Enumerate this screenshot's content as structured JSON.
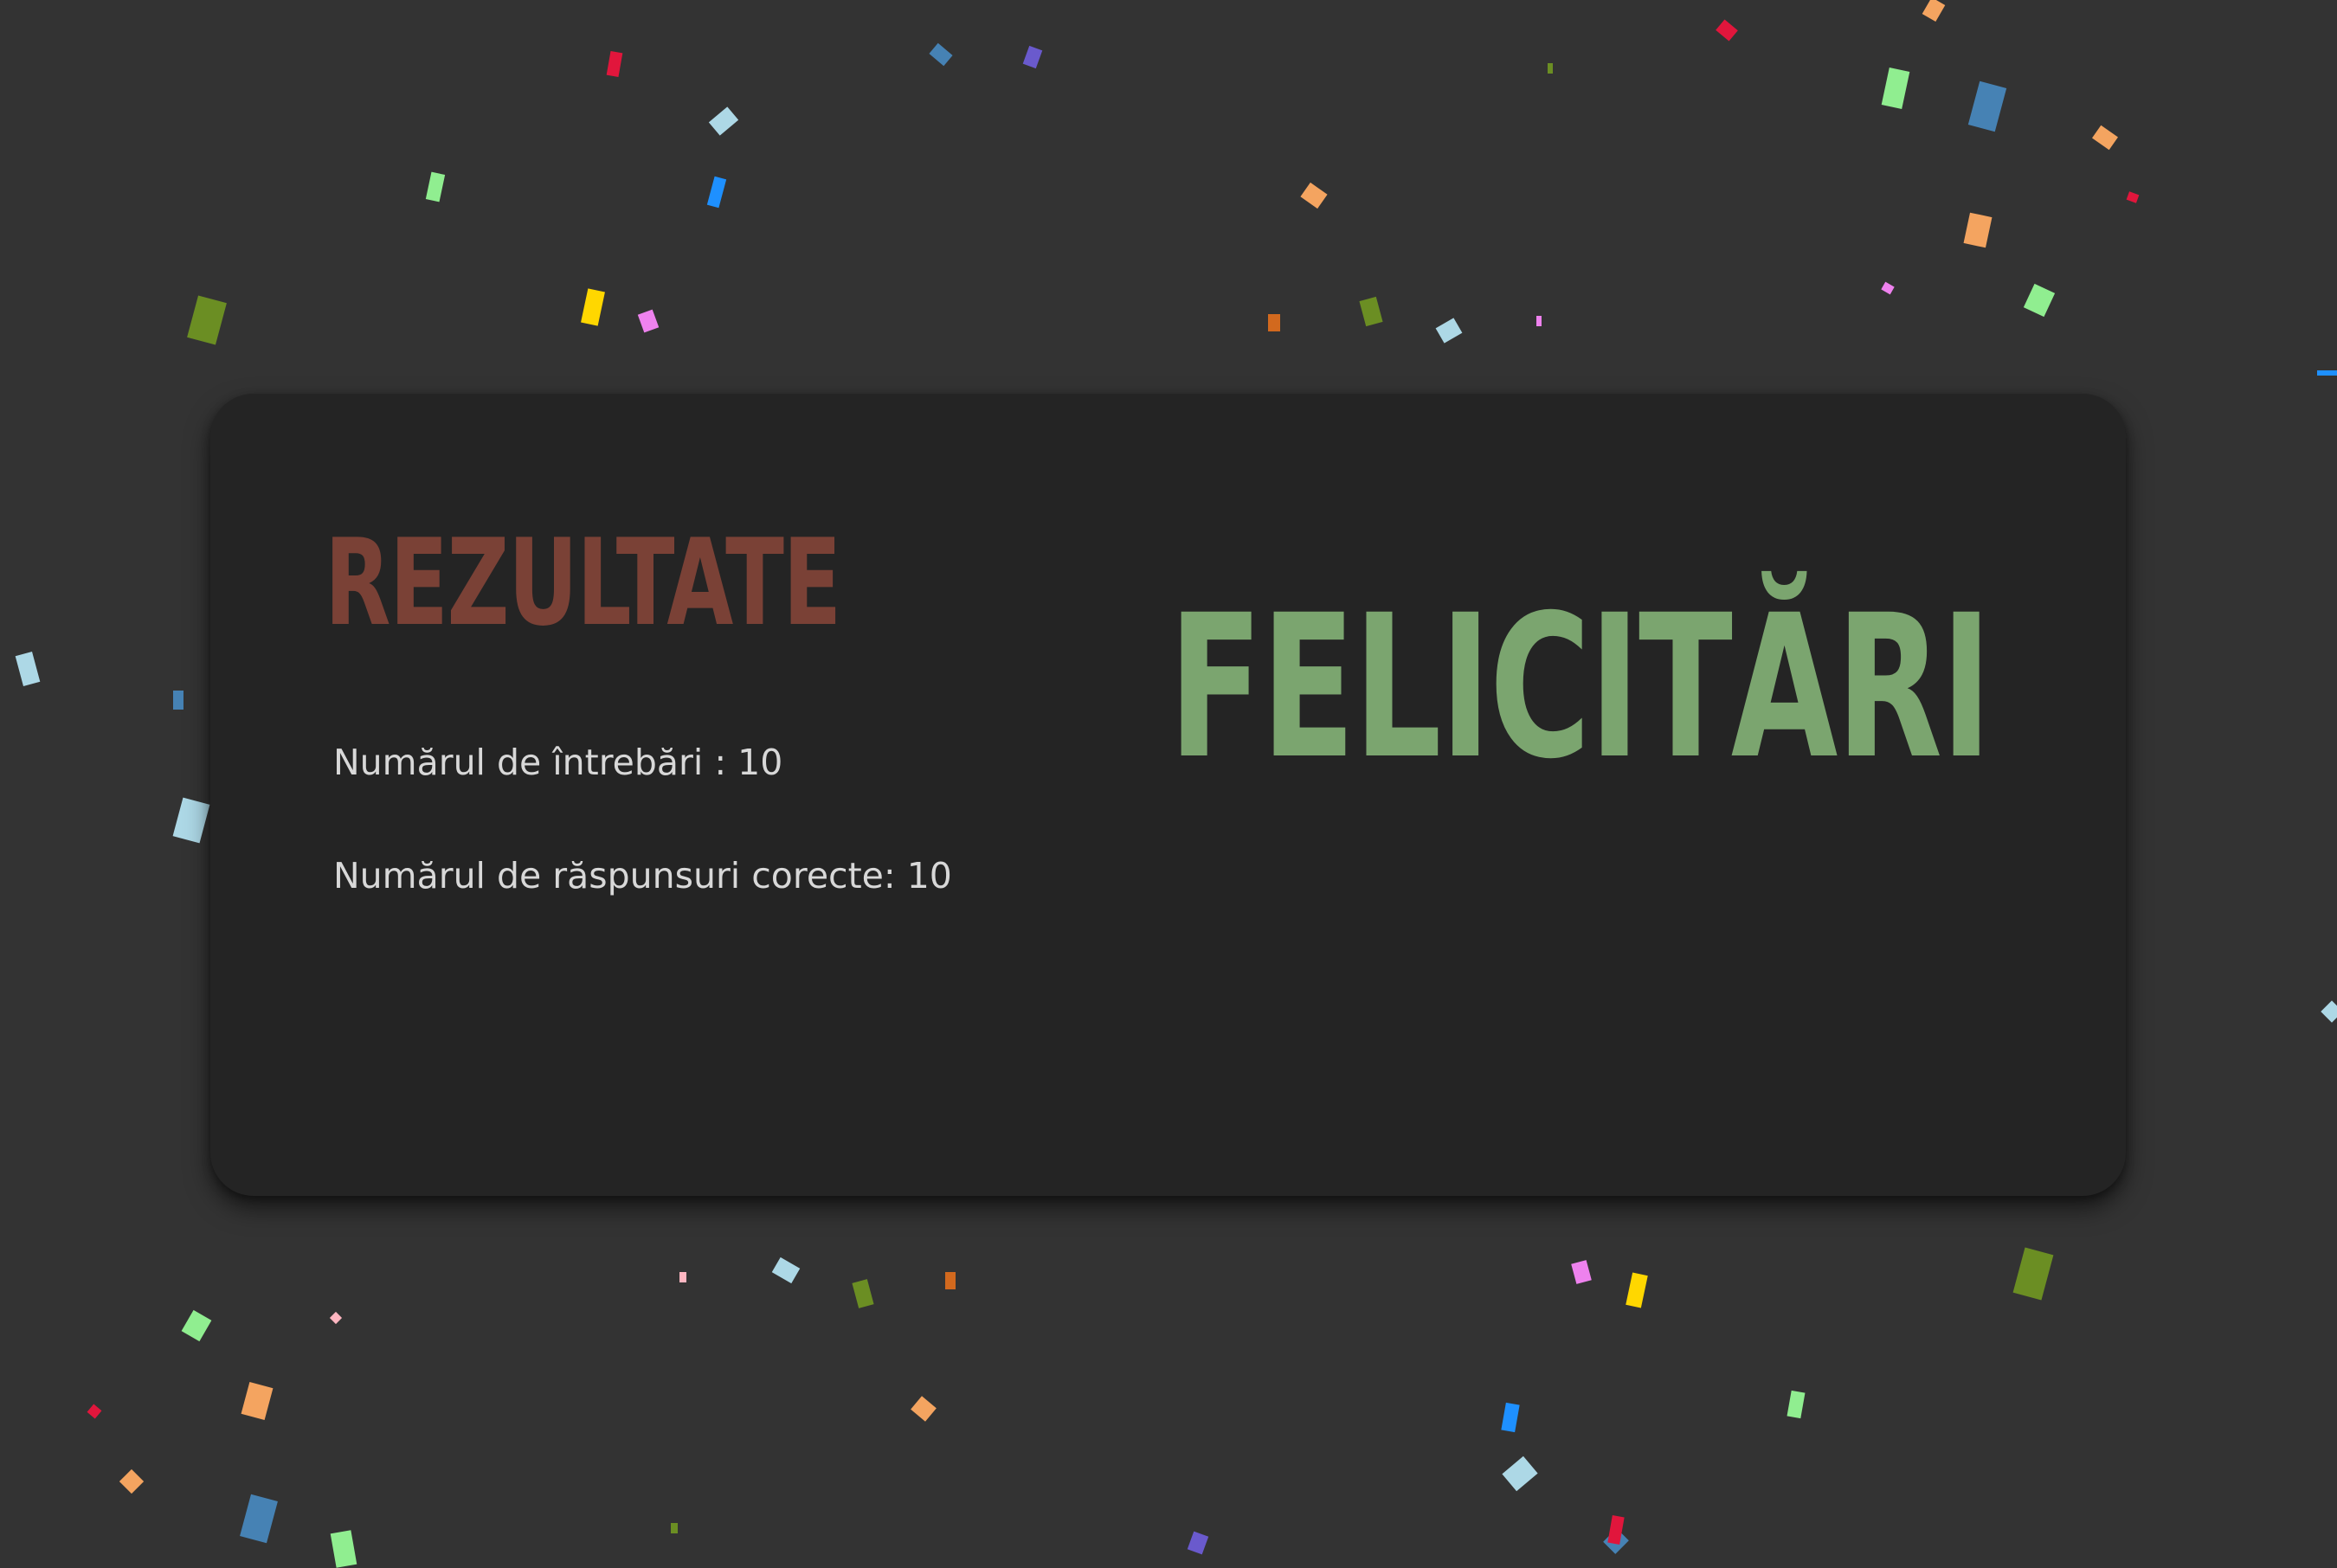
{
  "results": {
    "heading": "REZULTATE",
    "heading_color": "#7a4136",
    "questions_label": "Numărul de întrebări : 10",
    "correct_label": "Numărul de răspunsuri corecte: 10"
  },
  "congrats": {
    "text": "FELICITĂRI",
    "color": "#7ba56f"
  },
  "confetti_colors": [
    "#e1163c",
    "#4682b4",
    "#6a5acd",
    "#add8e6",
    "#90ee90",
    "#1e90ff",
    "#6b8e23",
    "#ffd700",
    "#ee82ee",
    "#f4a460",
    "#d2691e",
    "#ffb6c1"
  ]
}
